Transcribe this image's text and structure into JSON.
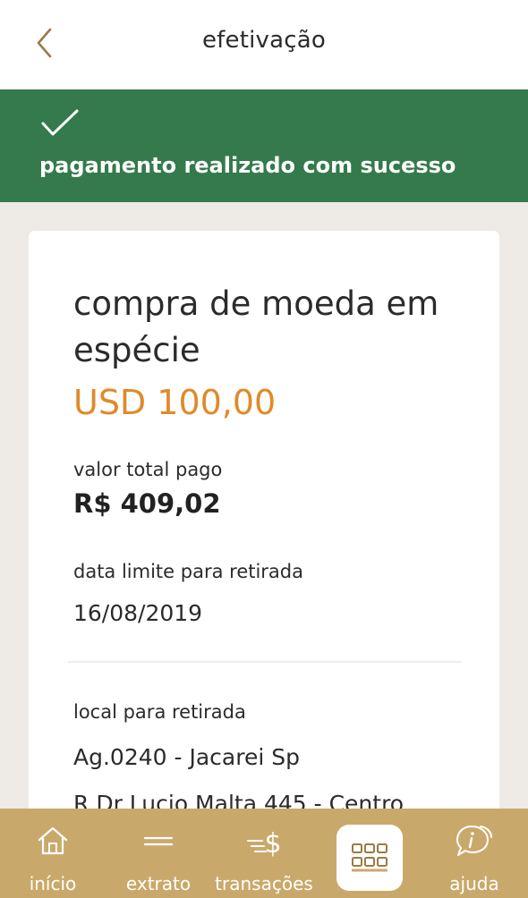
{
  "header": {
    "title": "efetivação",
    "back_icon": "chevron-left-icon"
  },
  "banner": {
    "icon": "check-icon",
    "message": "pagamento realizado com sucesso",
    "color": "#347a4c"
  },
  "receipt": {
    "product": "compra de moeda em espécie",
    "amount": "USD 100,00",
    "amount_color": "#e08a2a",
    "total_label": "valor total pago",
    "total_value": "R$ 409,02",
    "deadline_label": "data limite para retirada",
    "deadline_value": "16/08/2019",
    "location_label": "local para retirada",
    "location_branch": "Ag.0240 - Jacarei Sp",
    "location_address": "R Dr Lucio Malta 445 - Centro"
  },
  "tabbar": {
    "color": "#c9a96b",
    "items": [
      {
        "label": "início",
        "icon": "home-icon"
      },
      {
        "label": "extrato",
        "icon": "statement-lines-icon"
      },
      {
        "label": "transações",
        "icon": "dollar-transfer-icon"
      },
      {
        "label": "",
        "icon": "grid-menu-icon"
      },
      {
        "label": "ajuda",
        "icon": "help-chat-icon"
      }
    ]
  }
}
